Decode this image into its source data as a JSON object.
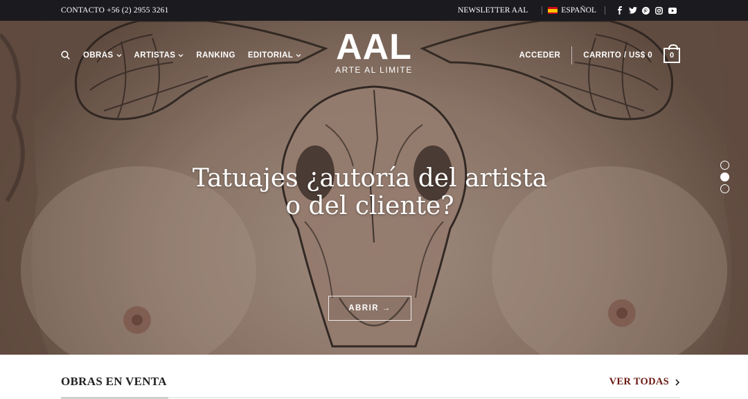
{
  "topbar": {
    "contact": "CONTACTO +56 (2) 2955 3261",
    "newsletter": "NEWSLETTER AAL",
    "language": "ESPAÑOL",
    "social_icons": [
      "facebook-icon",
      "twitter-icon",
      "pinterest-icon",
      "instagram-icon",
      "youtube-icon"
    ]
  },
  "header": {
    "logo_main": "AAL",
    "logo_sub": "ARTE AL LIMITE",
    "nav": [
      {
        "label": "OBRAS",
        "dropdown": true
      },
      {
        "label": "ARTISTAS",
        "dropdown": true
      },
      {
        "label": "RANKING",
        "dropdown": false
      },
      {
        "label": "EDITORIAL",
        "dropdown": true
      }
    ],
    "login": "ACCEDER",
    "cart_label": "CARRITO / US$ 0",
    "cart_count": "0"
  },
  "hero": {
    "headline_line1": "Tatuajes ¿autoría del artista",
    "headline_line2": "o del cliente?",
    "button": "ABRIR →",
    "slides_total": 3,
    "active_slide": 2
  },
  "section": {
    "title": "OBRAS EN VENTA",
    "link": "VER TODAS"
  },
  "colors": {
    "topbar_bg": "#1b1a1e",
    "link_color": "#6b1a14",
    "text_white": "#ffffff"
  }
}
